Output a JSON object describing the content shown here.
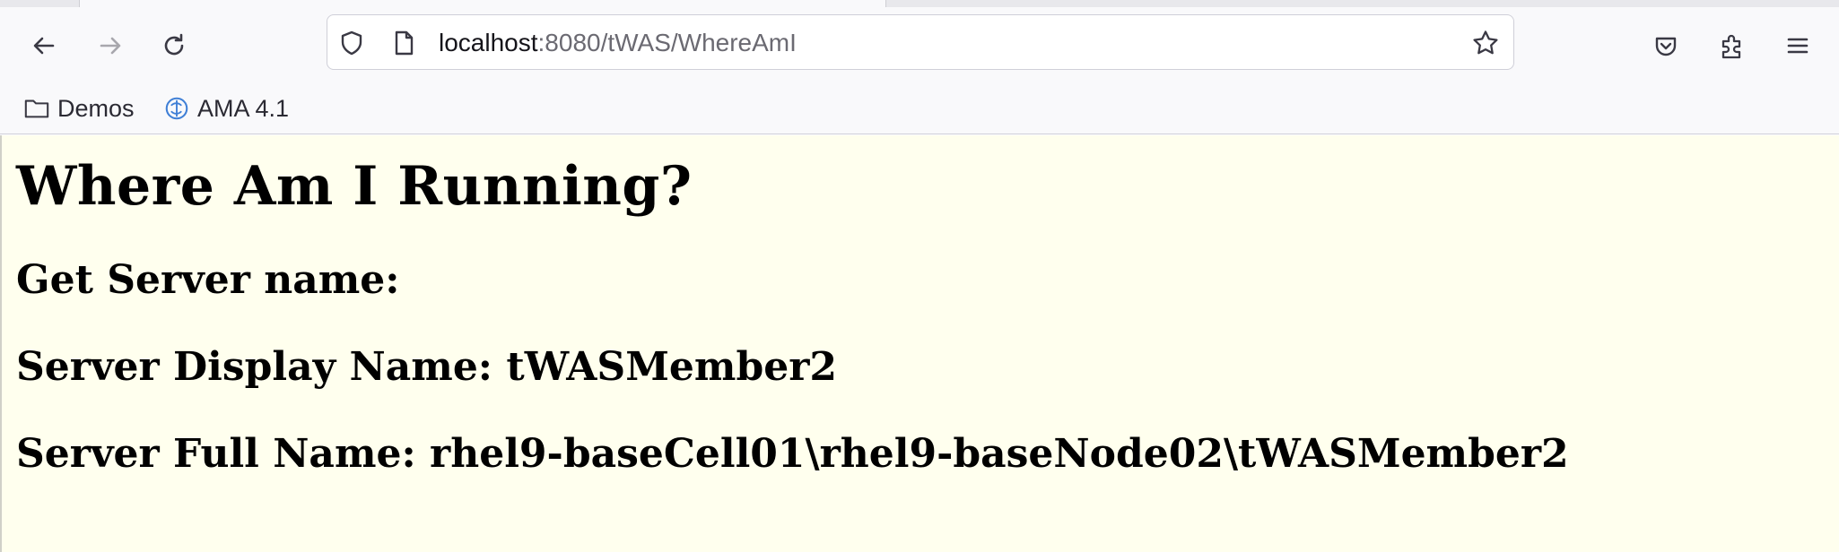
{
  "browser": {
    "url_host": "localhost",
    "url_rest": ":8080/tWAS/WhereAmI",
    "icons": [
      "back-arrow-icon",
      "forward-arrow-icon",
      "reload-icon",
      "shield-icon",
      "page-icon",
      "star-icon",
      "pocket-icon",
      "extensions-icon",
      "menu-icon"
    ]
  },
  "bookmarks": {
    "items": [
      {
        "label": "Demos",
        "icon": "folder-icon"
      },
      {
        "label": "AMA 4.1",
        "icon": "ama-icon"
      }
    ]
  },
  "page": {
    "background": "#ffffee",
    "title": "Where Am I Running?",
    "get_server_name": "Get Server name:",
    "display_name_line": "Server Display Name: tWASMember2",
    "full_name_line": "Server Full Name: rhel9-baseCell01\\rhel9-baseNode02\\tWASMember2"
  }
}
